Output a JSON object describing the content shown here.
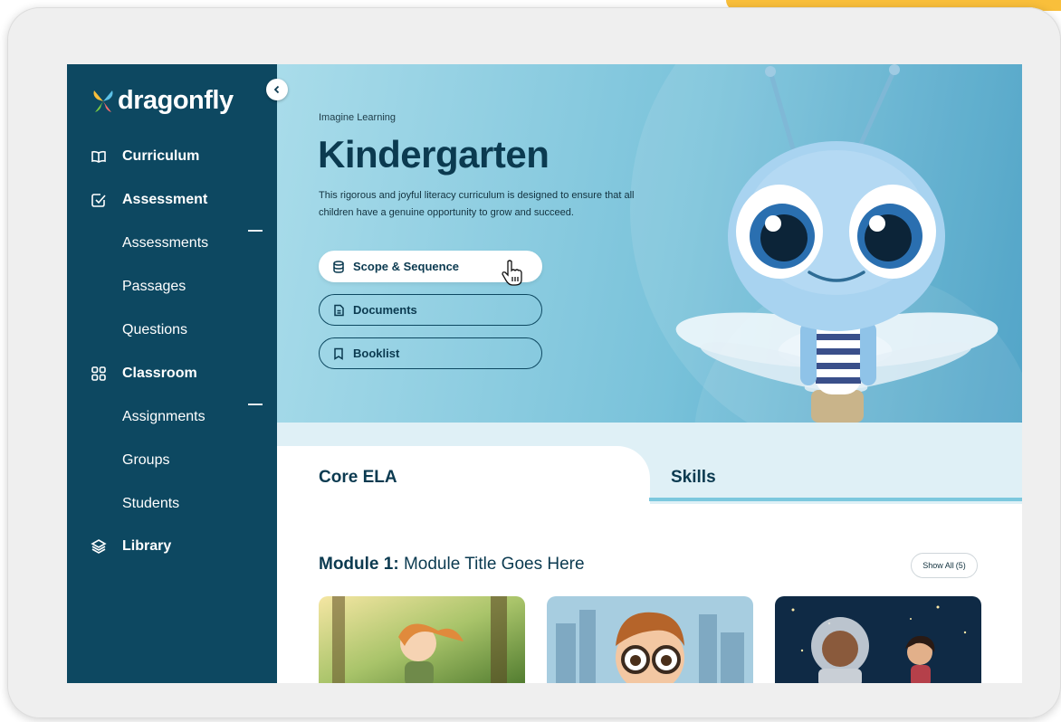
{
  "brand": {
    "logo_text": "dragonfly"
  },
  "sidebar": {
    "items": [
      {
        "label": "Curriculum",
        "type": "section",
        "icon": "book-open-icon"
      },
      {
        "label": "Assessment",
        "type": "section",
        "icon": "check-square-icon"
      },
      {
        "label": "Assessments",
        "type": "child"
      },
      {
        "label": "Passages",
        "type": "child"
      },
      {
        "label": "Questions",
        "type": "child"
      },
      {
        "label": "Classroom",
        "type": "section",
        "icon": "grid-icon"
      },
      {
        "label": "Assignments",
        "type": "child"
      },
      {
        "label": "Groups",
        "type": "child"
      },
      {
        "label": "Students",
        "type": "child"
      },
      {
        "label": "Library",
        "type": "section",
        "icon": "layers-icon"
      }
    ]
  },
  "hero": {
    "brand": "Imagine Learning",
    "title": "Kindergarten",
    "description": "This rigorous and joyful literacy curriculum is designed to ensure that all children have a genuine opportunity to grow and succeed.",
    "buttons": [
      {
        "label": "Scope & Sequence",
        "icon": "database-icon"
      },
      {
        "label": "Documents",
        "icon": "document-icon"
      },
      {
        "label": "Booklist",
        "icon": "bookmark-icon"
      }
    ]
  },
  "tabs": [
    {
      "label": "Core ELA",
      "active": true
    },
    {
      "label": "Skills",
      "active": false
    }
  ],
  "module": {
    "prefix": "Module 1:",
    "title": "Module Title Goes Here",
    "show_all_label": "Show All",
    "show_all_count": "(5)"
  },
  "colors": {
    "sidebar": "#0d4861",
    "hero_light": "#a9dcea",
    "hero_dark": "#3f9bc2",
    "accent": "#f9bf3b",
    "text_dark": "#0b3a50"
  }
}
